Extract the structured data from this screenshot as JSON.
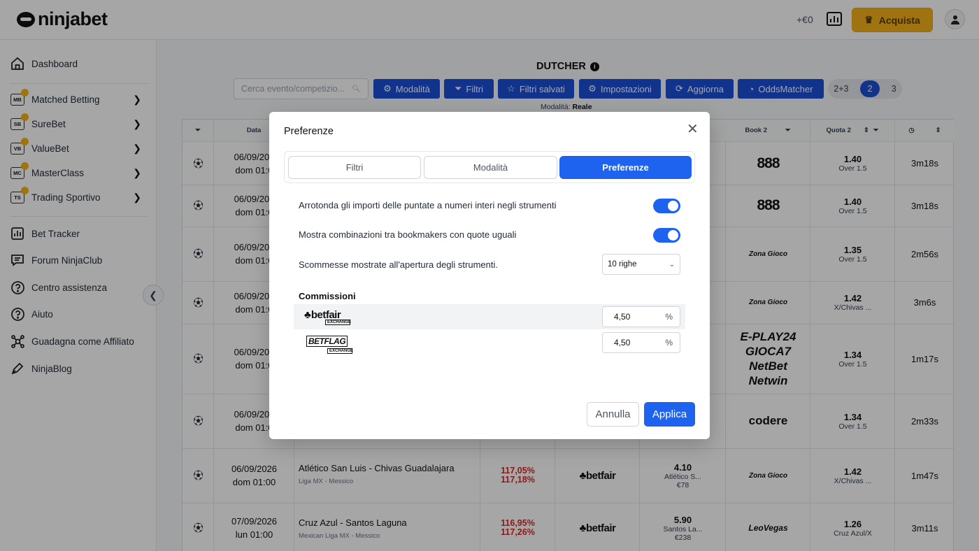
{
  "header": {
    "logo": "ninjabet",
    "balance": "+€0",
    "buy_label": "Acquista"
  },
  "sidebar": {
    "items": [
      {
        "label": "Dashboard"
      },
      {
        "label": "Matched Betting",
        "badge": "MB"
      },
      {
        "label": "SureBet",
        "badge": "SB"
      },
      {
        "label": "ValueBet",
        "badge": "VB"
      },
      {
        "label": "MasterClass",
        "badge": "MC"
      },
      {
        "label": "Trading Sportivo",
        "badge": "TS"
      },
      {
        "label": "Bet Tracker"
      },
      {
        "label": "Forum NinjaClub"
      },
      {
        "label": "Centro assistenza"
      },
      {
        "label": "Aiuto"
      },
      {
        "label": "Guadagna come Affiliato"
      },
      {
        "label": "NinjaBlog"
      }
    ]
  },
  "main": {
    "title": "DUTCHER",
    "search_placeholder": "Cerca evento/competizio...",
    "toolbar": {
      "mode": "Modalità",
      "filters": "Filtri",
      "saved": "Filtri salvati",
      "settings": "Impostazioni",
      "refresh": "Aggiorna",
      "oddsmatcher": "OddsMatcher"
    },
    "outcomes": [
      "2+3",
      "2",
      "3"
    ],
    "mode_label": "Modalità:",
    "mode_value": "Reale"
  },
  "table": {
    "headers": {
      "date": "Data",
      "book2": "Book 2",
      "quota2": "Quota 2"
    },
    "rows": [
      {
        "date": "06/09/202",
        "day": "dom 01:0",
        "book2": "888",
        "odd2": "1.40",
        "sel2": "Over 1.5",
        "time": "3m18s"
      },
      {
        "date": "06/09/202",
        "day": "dom 01:0",
        "book2": "888",
        "odd2": "1.40",
        "sel2": "Over 1.5",
        "time": "3m18s"
      },
      {
        "date": "06/09/202",
        "day": "dom 01:0",
        "book2": "Zona Gioco",
        "odd2": "1.35",
        "sel2": "Over 1.5",
        "time": "2m56s"
      },
      {
        "date": "06/09/202",
        "day": "dom 01:0",
        "book2": "Zona Gioco",
        "odd2": "1.42",
        "sel2": "X/Chivas ...",
        "time": "3m6s"
      },
      {
        "date": "06/09/202",
        "day": "dom 01:0",
        "book2_lines": [
          "E-PLAY24",
          "GIOCA7",
          "NetBet",
          "Netwin"
        ],
        "odd2": "1.34",
        "sel2": "Over 1.5",
        "time": "1m17s"
      },
      {
        "date": "06/09/202",
        "day": "dom 01:0",
        "book2": "codere",
        "odd2": "1.34",
        "sel2": "Over 1.5",
        "time": "2m33s"
      },
      {
        "date": "06/09/2026",
        "day": "dom 01:00",
        "event": "Atlético San Luis - Chivas Guadalajara",
        "league": "Liga MX - Messico",
        "rating1": "117,05%",
        "rating2": "117,18%",
        "book1": "betfair",
        "odd1": "4.10",
        "sel1": "Atlético S...",
        "stake1": "€78",
        "book2": "Zona Gioco",
        "odd2": "1.42",
        "sel2": "X/Chivas ...",
        "time": "1m47s"
      },
      {
        "date": "07/09/2026",
        "day": "lun 01:00",
        "event": "Cruz Azul - Santos Laguna",
        "league": "Mexican Liga MX - Messico",
        "rating1": "116,95%",
        "rating2": "117,26%",
        "book1": "betfair",
        "odd1": "5.90",
        "sel1": "Santos La...",
        "stake1": "€238",
        "book2": "LeoVegas",
        "odd2": "1.26",
        "sel2": "Cruz Azul/X",
        "time": "3m11s"
      }
    ]
  },
  "modal": {
    "title": "Preferenze",
    "tabs": [
      "Filtri",
      "Modalità",
      "Preferenze"
    ],
    "pref_round": "Arrotonda gli importi delle puntate a numeri interi negli strumenti",
    "pref_combos": "Mostra combinazioni tra bookmakers con quote uguali",
    "pref_rows": "Scommesse mostrate all'apertura degli strumenti.",
    "rows_select": "10 righe",
    "commissions_title": "Commissioni",
    "commissions": [
      {
        "name": "betfair",
        "sub": "EXCHANGE",
        "value": "4,50",
        "unit": "%"
      },
      {
        "name": "BETFLAG",
        "sub": "EXCHANGE",
        "value": "4,50",
        "unit": "%"
      }
    ],
    "cancel": "Annulla",
    "apply": "Applica"
  },
  "colors": {
    "primary": "#1d4fd8",
    "accent": "#f5b21a",
    "negative": "#dc2626"
  }
}
